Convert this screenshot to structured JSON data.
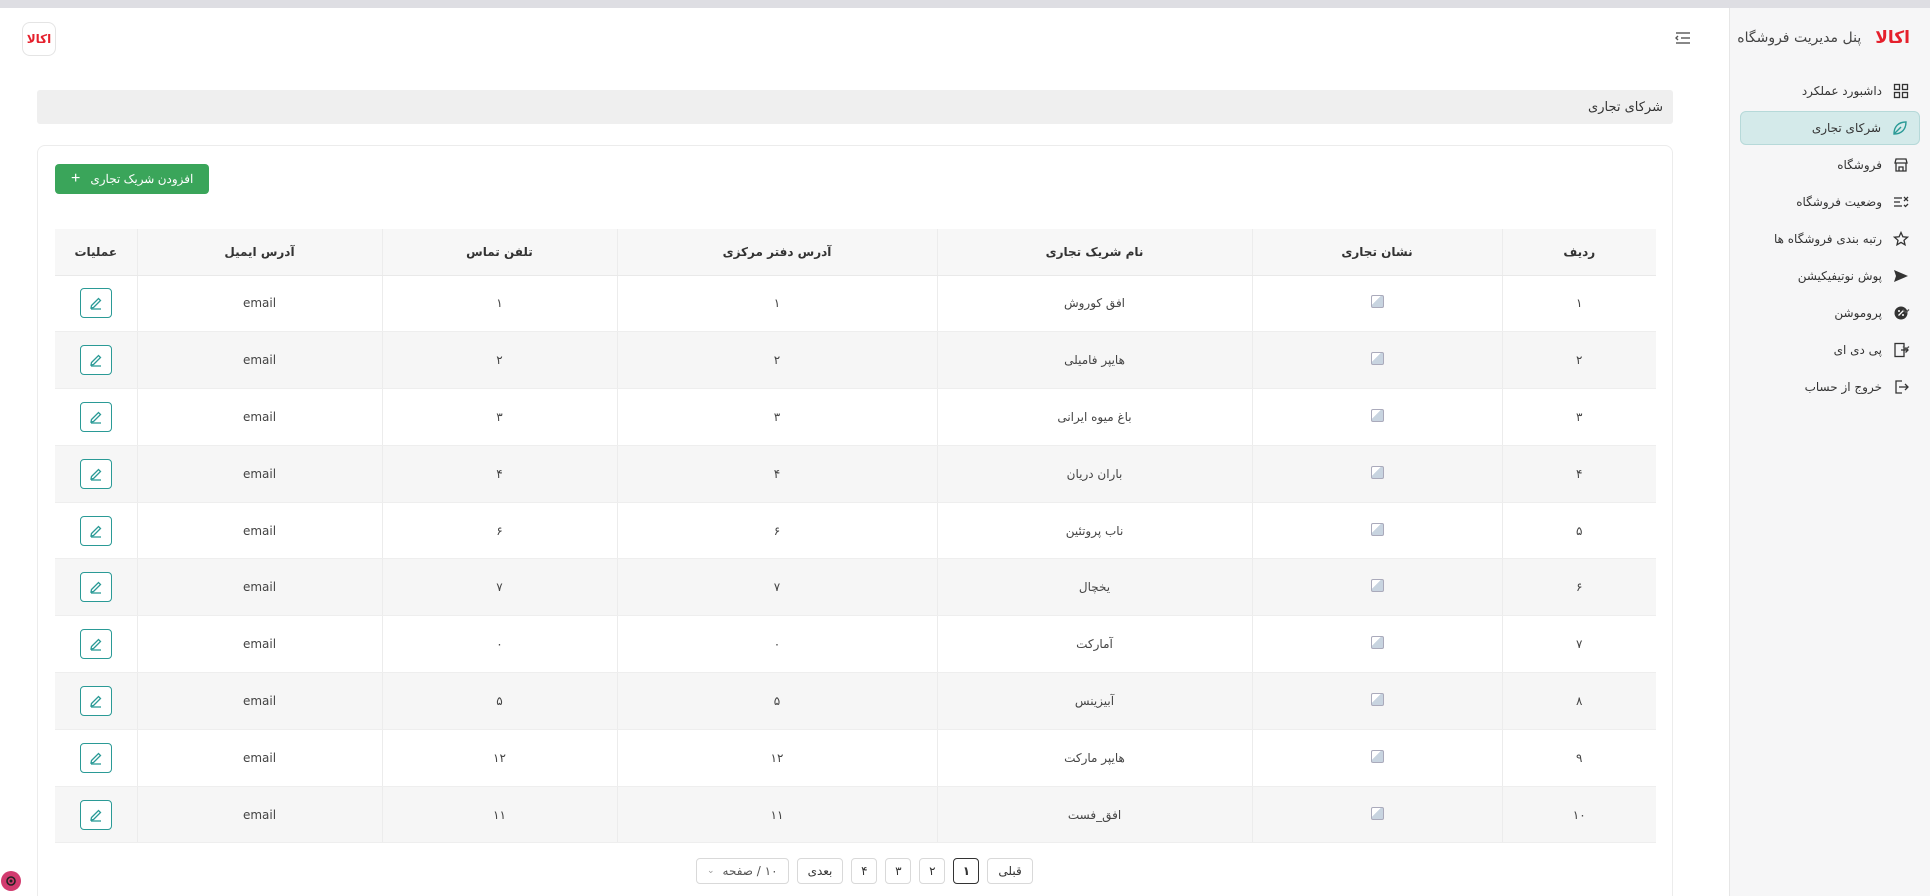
{
  "app": {
    "brand": "اکالا",
    "title": "پنل مدیریت فروشگاه"
  },
  "colors": {
    "accent": "#2a9a96",
    "primary_button": "#3aa55a",
    "brand_red": "#e5202c",
    "active_item_bg": "#d4eaea"
  },
  "sidebar": {
    "items": [
      {
        "label": "داشبورد عملکرد",
        "icon": "dashboard-grid-icon"
      },
      {
        "label": "شرکای تجاری",
        "icon": "leaf-icon",
        "active": true
      },
      {
        "label": "فروشگاه",
        "icon": "store-icon"
      },
      {
        "label": "وضعیت فروشگاه",
        "icon": "list-status-icon"
      },
      {
        "label": "رتبه بندی فروشگاه ها",
        "icon": "star-icon"
      },
      {
        "label": "پوش نوتیفیکیشن",
        "icon": "send-icon"
      },
      {
        "label": "پروموشن",
        "icon": "badge-percent-icon",
        "expandable": true
      },
      {
        "label": "پی دی ای",
        "icon": "door-exit-icon",
        "expandable": true
      },
      {
        "label": "خروج از حساب",
        "icon": "logout-icon"
      }
    ]
  },
  "page": {
    "title": "شرکای تجاری",
    "add_button": "افزودن شریک تجاری"
  },
  "table": {
    "columns": [
      "ردیف",
      "نشان تجاری",
      "نام شریک تجاری",
      "آدرس دفتر مرکزی",
      "تلفن تماس",
      "آدرس ایمیل",
      "عملیات"
    ],
    "rows": [
      {
        "index": "۱",
        "name": "افق کوروش",
        "address": "۱",
        "phone": "۱",
        "email": "email"
      },
      {
        "index": "۲",
        "name": "هایپر فامیلی",
        "address": "۲",
        "phone": "۲",
        "email": "email"
      },
      {
        "index": "۳",
        "name": "باغ میوه ایرانی",
        "address": "۳",
        "phone": "۳",
        "email": "email"
      },
      {
        "index": "۴",
        "name": "باران دریان",
        "address": "۴",
        "phone": "۴",
        "email": "email"
      },
      {
        "index": "۵",
        "name": "ناب پروتئین",
        "address": "۶",
        "phone": "۶",
        "email": "email"
      },
      {
        "index": "۶",
        "name": "یخچال",
        "address": "۷",
        "phone": "۷",
        "email": "email"
      },
      {
        "index": "۷",
        "name": "آمارکت",
        "address": "۰",
        "phone": "۰",
        "email": "email"
      },
      {
        "index": "۸",
        "name": "آبیزینس",
        "address": "۵",
        "phone": "۵",
        "email": "email"
      },
      {
        "index": "۹",
        "name": "هایپر مارکت",
        "address": "۱۲",
        "phone": "۱۲",
        "email": "email"
      },
      {
        "index": "۱۰",
        "name": "افق_فست",
        "address": "۱۱",
        "phone": "۱۱",
        "email": "email"
      }
    ]
  },
  "pagination": {
    "prev": "قبلی",
    "pages": [
      "۱",
      "۲",
      "۳",
      "۴"
    ],
    "current": "۱",
    "next": "بعدی",
    "page_size": "۱۰ / صفحه"
  }
}
